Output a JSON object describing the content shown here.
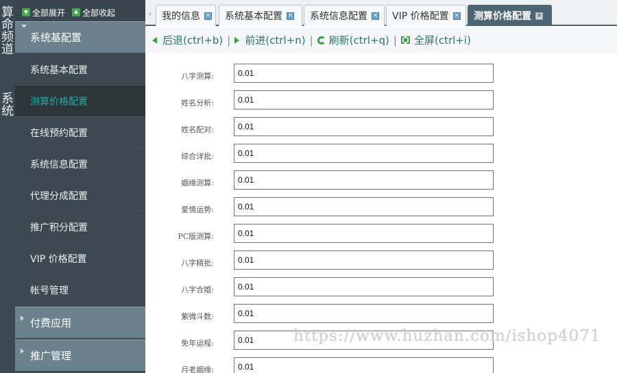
{
  "left_strip": {
    "text_top": "算命频道",
    "text_bottom": "系统"
  },
  "sidebar": {
    "expand_all": "全部展开",
    "collapse_all": "全部收起",
    "groups": [
      {
        "label": "系统基配置",
        "items": [
          "系统基本配置",
          "测算价格配置",
          "在线预约配置",
          "系统信息配置",
          "代理分成配置",
          "推广积分配置",
          "VIP 价格配置",
          "帐号管理"
        ]
      },
      {
        "label": "付费应用"
      },
      {
        "label": "推广管理"
      }
    ],
    "active_item": "测算价格配置"
  },
  "tabs": [
    {
      "label": "我的信息"
    },
    {
      "label": "系统基本配置"
    },
    {
      "label": "系统信息配置"
    },
    {
      "label": "VIP 价格配置"
    },
    {
      "label": "测算价格配置",
      "active": true
    }
  ],
  "toolbar": {
    "back": "后退(ctrl+b)",
    "forward": "前进(ctrl+n)",
    "refresh": "刷新(ctrl+q)",
    "fullscreen": "全屏(ctrl+i)",
    "separator": "|"
  },
  "form": {
    "fields": [
      {
        "label": "八字测算:",
        "value": "0.01"
      },
      {
        "label": "姓名分析:",
        "value": "0.01"
      },
      {
        "label": "姓名配对:",
        "value": "0.01"
      },
      {
        "label": "综合详批:",
        "value": "0.01"
      },
      {
        "label": "姻缘测算:",
        "value": "0.01"
      },
      {
        "label": "爱情运势:",
        "value": "0.01"
      },
      {
        "label": "PC版测算:",
        "value": "0.01"
      },
      {
        "label": "八字精批:",
        "value": "0.01"
      },
      {
        "label": "八字合婚:",
        "value": "0.01"
      },
      {
        "label": "紫微斗数:",
        "value": "0.01"
      },
      {
        "label": "免年运程:",
        "value": "0.01"
      },
      {
        "label": "月老姻缘:",
        "value": "0.01"
      }
    ]
  },
  "watermark": "https://www.huzhan.com/ishop4071",
  "colors": {
    "sidebar_bg": "#3d4950",
    "group_header_bg": "#6b828d",
    "active_item_text": "#29a8a0",
    "active_tab_bg": "#4d6570",
    "toolbar_text": "#2b7a63"
  }
}
